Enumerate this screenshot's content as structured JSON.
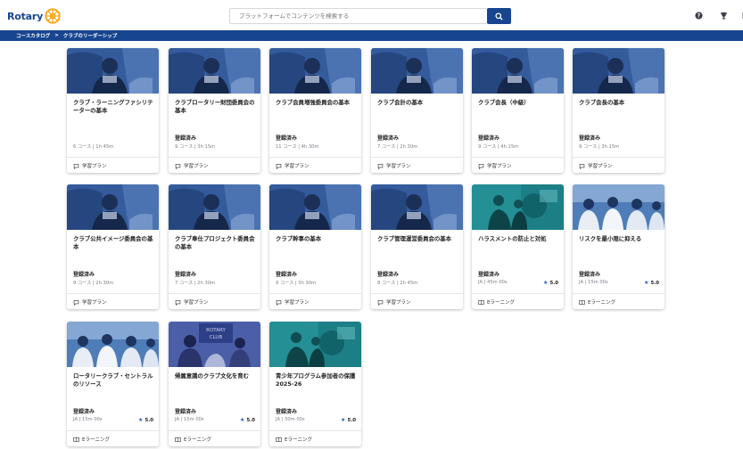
{
  "header": {
    "logo_text": "Rotary",
    "search_placeholder": "プラットフォームでコンテンツを検索する"
  },
  "breadcrumb": {
    "items": [
      "コースカタログ",
      "クラブのリーダーシップ"
    ],
    "separator": ">"
  },
  "colors": {
    "brand": "#17458f",
    "gold": "#f7a81b",
    "star": "#1f5bb8"
  },
  "cards": [
    {
      "title": "クラブ・ラーニングファシリテーターの基本",
      "status": "",
      "meta": "6 コース | 1h 45m",
      "rating": "",
      "footer": "学習プラン",
      "footer_icon": "plan-icon",
      "thumb": "portrait"
    },
    {
      "title": "クラブロータリー財団委員会の基本",
      "status": "登録済み",
      "meta": "9 コース | 3h 15m",
      "rating": "",
      "footer": "学習プラン",
      "footer_icon": "plan-icon",
      "thumb": "portrait"
    },
    {
      "title": "クラブ会員増強委員会の基本",
      "status": "登録済み",
      "meta": "11 コース | 4h 30m",
      "rating": "",
      "footer": "学習プラン",
      "footer_icon": "plan-icon",
      "thumb": "portrait"
    },
    {
      "title": "クラブ会計の基本",
      "status": "登録済み",
      "meta": "7 コース | 2h 30m",
      "rating": "",
      "footer": "学習プラン",
      "footer_icon": "plan-icon",
      "thumb": "portrait"
    },
    {
      "title": "クラブ会長（中級）",
      "status": "登録済み",
      "meta": "9 コース | 4h 15m",
      "rating": "",
      "footer": "学習プラン",
      "footer_icon": "plan-icon",
      "thumb": "portrait"
    },
    {
      "title": "クラブ会長の基本",
      "status": "登録済み",
      "meta": "9 コース | 3h 15m",
      "rating": "",
      "footer": "学習プラン",
      "footer_icon": "plan-icon",
      "thumb": "portrait"
    },
    {
      "title": "クラブ公共イメージ委員会の基本",
      "status": "登録済み",
      "meta": "9 コース | 2h 30m",
      "rating": "",
      "footer": "学習プラン",
      "footer_icon": "plan-icon",
      "thumb": "portrait"
    },
    {
      "title": "クラブ奉仕プロジェクト委員会の基本",
      "status": "登録済み",
      "meta": "7 コース | 2h 30m",
      "rating": "",
      "footer": "学習プラン",
      "footer_icon": "plan-icon",
      "thumb": "portrait"
    },
    {
      "title": "クラブ幹事の基本",
      "status": "登録済み",
      "meta": "9 コース | 3h 30m",
      "rating": "",
      "footer": "学習プラン",
      "footer_icon": "plan-icon",
      "thumb": "portrait"
    },
    {
      "title": "クラブ管理運営委員会の基本",
      "status": "登録済み",
      "meta": "8 コース | 2h 45m",
      "rating": "",
      "footer": "学習プラン",
      "footer_icon": "plan-icon",
      "thumb": "portrait"
    },
    {
      "title": "ハラスメントの防止と対処",
      "status": "登録済み",
      "meta": "JA | 45m 00s",
      "rating": "5.0",
      "footer": "Eラーニング",
      "footer_icon": "elearning-icon",
      "thumb": "teal"
    },
    {
      "title": "リスクを最小限に抑える",
      "status": "登録済み",
      "meta": "JA | 15m 00s",
      "rating": "5.0",
      "footer": "Eラーニング",
      "footer_icon": "elearning-icon",
      "thumb": "group"
    },
    {
      "title": "ロータリークラブ・セントラルのリソース",
      "status": "登録済み",
      "meta": "JA | 15m 00s",
      "rating": "5.0",
      "footer": "Eラーニング",
      "footer_icon": "elearning-icon",
      "thumb": "group"
    },
    {
      "title": "帰属意識のクラブ文化を育む",
      "status": "登録済み",
      "meta": "JA | 15m 00s",
      "rating": "5.0",
      "footer": "Eラーニング",
      "footer_icon": "elearning-icon",
      "thumb": "club"
    },
    {
      "title": "青少年プログラム参加者の保護 2025-26",
      "status": "登録済み",
      "meta": "JA | 30m 00s",
      "rating": "5.0",
      "footer": "Eラーニング",
      "footer_icon": "elearning-icon",
      "thumb": "teal"
    }
  ]
}
